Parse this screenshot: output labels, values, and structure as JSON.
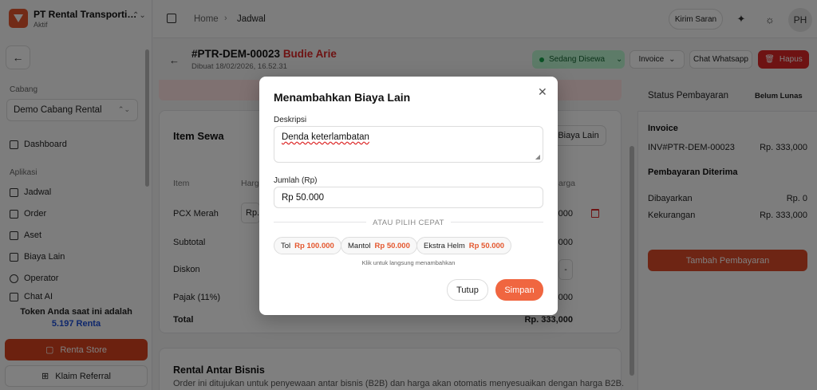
{
  "app": {
    "org_name": "PT Rental Transporti…",
    "org_status": "Aktif"
  },
  "sidebar": {
    "branch_label": "Cabang",
    "branch_value": "Demo Cabang Rental",
    "dashboard_label": "Dashboard",
    "section_label": "Aplikasi",
    "items": [
      {
        "label": "Jadwal",
        "icon": "calendar-icon"
      },
      {
        "label": "Order",
        "icon": "clipboard-icon"
      },
      {
        "label": "Aset",
        "icon": "box-icon"
      },
      {
        "label": "Biaya Lain",
        "icon": "receipt-icon"
      },
      {
        "label": "Operator",
        "icon": "user-icon"
      },
      {
        "label": "Chat AI",
        "icon": "chat-icon"
      }
    ],
    "token_text": "Token Anda saat ini adalah",
    "token_value": "5.197 Renta",
    "store_button": "Renta Store",
    "referral_button": "Klaim Referral"
  },
  "header": {
    "breadcrumb_home": "Home",
    "breadcrumb_current": "Jadwal",
    "feedback_button": "Kirim Saran",
    "avatar_initials": "PH"
  },
  "order": {
    "id": "#PTR-DEM-00023",
    "customer": "Budie Arie",
    "created": "Dibuat 18/02/2026, 16.52.31",
    "status": "Sedang Disewa",
    "invoice_button": "Invoice",
    "whatsapp_button": "Chat Whatsapp",
    "delete_button": "Hapus"
  },
  "items_card": {
    "title": "Item Sewa",
    "add_cost_button": "Biaya Lain",
    "col_item": "Item",
    "col_price": "Harga",
    "col_price_right": "arga",
    "row_item": "PCX Merah",
    "row_qty": "Rp.",
    "row_item_value": "000",
    "subtotal_label": "Subtotal",
    "subtotal_value": "000",
    "discount_label": "Diskon",
    "discount_input": "-",
    "tax_label": "Pajak (11%)",
    "tax_value": "000",
    "total_label": "Total",
    "total_value": "Rp. 333,000"
  },
  "b2b": {
    "title": "Rental Antar Bisnis",
    "description": "Order ini ditujukan untuk penyewaan antar bisnis (B2B) dan harga akan otomatis menyesuaikan dengan harga B2B."
  },
  "payment_panel": {
    "title": "Status Pembayaran",
    "badge": "Belum Lunas",
    "invoice_heading": "Invoice",
    "invoice_number": "INV#PTR-DEM-00023",
    "invoice_amount": "Rp. 333,000",
    "received_heading": "Pembayaran Diterima",
    "paid_label": "Dibayarkan",
    "paid_value": "Rp. 0",
    "shortfall_label": "Kekurangan",
    "shortfall_value": "Rp. 333,000",
    "add_payment_button": "Tambah Pembayaran"
  },
  "modal": {
    "title": "Menambahkan Biaya Lain",
    "description_label": "Deskripsi",
    "description_value": "Denda keterlambatan",
    "amount_label": "Jumlah (Rp)",
    "amount_value": "Rp 50.000",
    "quick_pick_label": "ATAU PILIH CEPAT",
    "chips": [
      {
        "name": "Tol",
        "price": "Rp 100.000"
      },
      {
        "name": "Mantol",
        "price": "Rp 50.000"
      },
      {
        "name": "Ekstra Helm",
        "price": "Rp 50.000"
      }
    ],
    "hint": "Klik untuk langsung menambahkan",
    "close_button": "Tutup",
    "save_button": "Simpan"
  },
  "colors": {
    "accent": "#e4572e",
    "danger": "#dc2626",
    "status_green": "#bbf7d0"
  }
}
